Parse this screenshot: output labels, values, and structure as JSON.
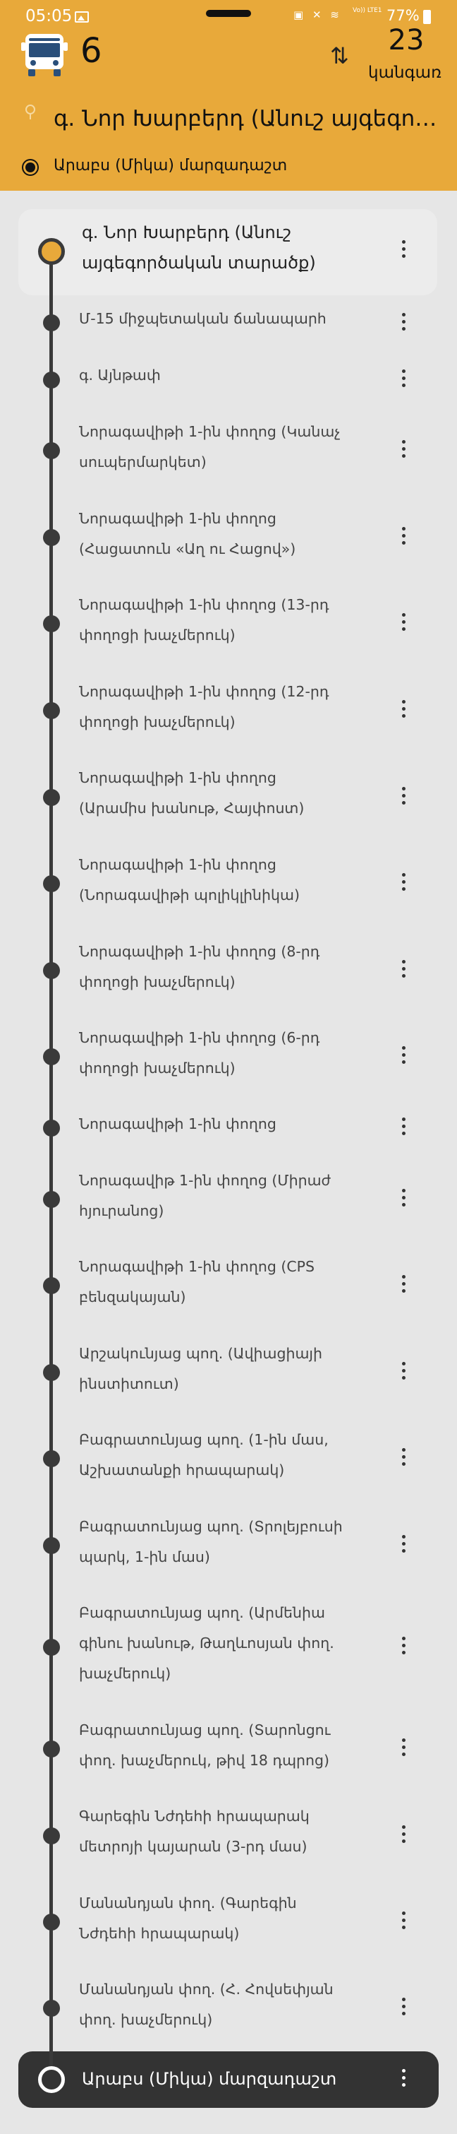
{
  "status_bar": {
    "time": "05:05",
    "signal_text": "Vo)) LTE1",
    "battery": "77%"
  },
  "header": {
    "route_number": "6",
    "stop_count": "23",
    "stop_count_label": "կանգառ",
    "from": "գ. Նոր Խարբերդ (Անուշ այգեգործական տարածք)",
    "to": "Արաբս (Միկա) մարզադաշտ",
    "colors": {
      "accent": "#e8a93a",
      "line": "#3a3a3a"
    },
    "icons": [
      "bus-icon",
      "swap-icon",
      "pin-icon"
    ]
  },
  "stops": [
    "գ. Նոր Խարբերդ (Անուշ այգեգործական տարածք)",
    "Մ-15 միջպետական ճանապարհ",
    "գ. Այնթափ",
    "Նորագավիթի 1-ին փողոց (Կանաչ սուպերմարկետ)",
    "Նորագավիթի 1-ին փողոց (Հացատուն «Աղ ու Հացով»)",
    "Նորագավիթի 1-ին փողոց (13-րդ փողոցի խաչմերուկ)",
    "Նորագավիթի 1-ին փողոց (12-րդ փողոցի խաչմերուկ)",
    "Նորագավիթի 1-ին փողոց (Արամիս խանութ, Հայփոստ)",
    "Նորագավիթի 1-ին փողոց (Նորագավիթի պոլիկլինիկա)",
    "Նորագավիթի 1-ին փողոց (8-րդ փողոցի խաչմերուկ)",
    "Նորագավիթի 1-ին փողոց (6-րդ փողոցի խաչմերուկ)",
    "Նորագավիթի 1-ին փողոց",
    "Նորագավիթ 1-ին փողոց (Միրաժ հյուրանոց)",
    "Նորագավիթի 1-ին փողոց (CPS բենզակայան)",
    "Արշակունյաց պող. (Ավիացիայի ինստիտուտ)",
    "Բագրատունյաց պող. (1-ին մաս, Աշխատանքի հրապարակ)",
    "Բագրատունյաց պող. (Տրոլեյբուսի պարկ, 1-ին մաս)",
    "Բագրատունյաց պող. (Արմենիա գինու խանութ, Թաղևոսյան փող. խաչմերուկ)",
    "Բագրատունյաց պող. (Տարոնցու փող. խաչմերուկ, թիվ 18 դպրոց)",
    "Գարեգին Նժդեհի հրապարակ մետրոյի կայարան (3-րդ մաս)",
    "Մանանդյան փող. (Գարեգին Նժդեհի հրապարակ)",
    "Մանանդյան փող. (Հ. Հովսեփյան փող. խաչմերուկ)",
    "Արաբս (Միկա) մարզադաշտ"
  ]
}
